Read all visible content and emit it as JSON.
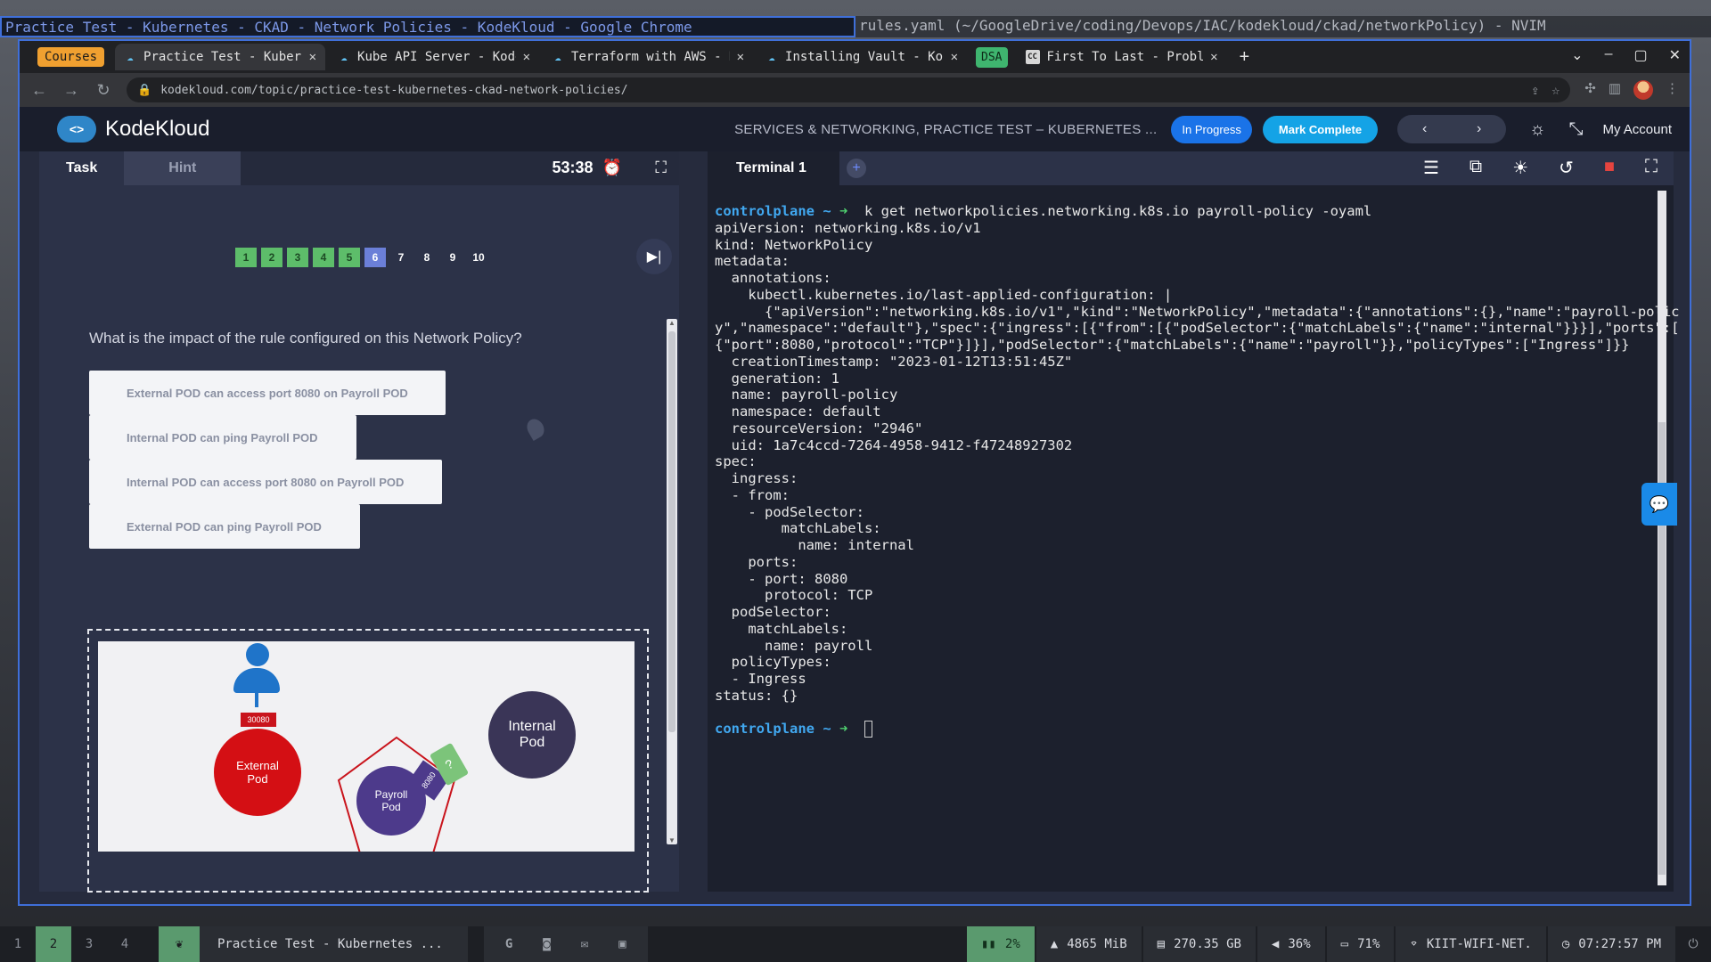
{
  "wm": {
    "left_title": "Practice Test - Kubernetes - CKAD - Network Policies - KodeKloud - Google Chrome",
    "right_title": "rules.yaml (~/GoogleDrive/coding/Devops/IAC/kodekloud/ckad/networkPolicy) - NVIM"
  },
  "browser": {
    "courses_badge": "Courses",
    "tabs": [
      {
        "label": "Practice Test - Kuberr",
        "active": true
      },
      {
        "label": "Kube API Server - Kode",
        "active": false
      },
      {
        "label": "Terraform with AWS - K",
        "active": false
      },
      {
        "label": "Installing Vault - Koc",
        "active": false
      },
      {
        "label": "First To Last - Proble",
        "active": false
      }
    ],
    "dsa_badge": "DSA",
    "cc_icon": "CC",
    "url": "kodekloud.com/topic/practice-test-kubernetes-ckad-network-policies/"
  },
  "header": {
    "logo_text": "KodeKloud",
    "course_title": "SERVICES & NETWORKING, PRACTICE TEST – KUBERNETES ...",
    "in_progress": "In Progress",
    "mark_complete": "Mark Complete",
    "my_account": "My Account"
  },
  "task": {
    "tab_task": "Task",
    "tab_hint": "Hint",
    "timer": "53:38",
    "question_numbers": [
      {
        "n": "1",
        "state": "done"
      },
      {
        "n": "2",
        "state": "done"
      },
      {
        "n": "3",
        "state": "done"
      },
      {
        "n": "4",
        "state": "done"
      },
      {
        "n": "5",
        "state": "done"
      },
      {
        "n": "6",
        "state": "current"
      },
      {
        "n": "7",
        "state": "todo"
      },
      {
        "n": "8",
        "state": "todo"
      },
      {
        "n": "9",
        "state": "todo"
      },
      {
        "n": "10",
        "state": "todo"
      }
    ],
    "question": "What is the impact of the rule configured on this Network Policy?",
    "options": [
      "External POD can access port 8080 on Payroll POD",
      "Internal POD can ping Payroll POD",
      "Internal POD can access port 8080 on Payroll POD",
      "External POD can ping Payroll POD"
    ],
    "diagram": {
      "port_label": "30080",
      "external_pod_l1": "External",
      "external_pod_l2": "Pod",
      "payroll_pod_l1": "Payroll",
      "payroll_pod_l2": "Pod",
      "internal_pod_l1": "Internal",
      "internal_pod_l2": "Pod",
      "tag_port": "8080",
      "tag_green": "?"
    }
  },
  "terminal": {
    "tab_label": "Terminal 1",
    "prompt": "controlplane ~",
    "command": "k get networkpolicies.networking.k8s.io payroll-policy -oyaml",
    "output": [
      "apiVersion: networking.k8s.io/v1",
      "kind: NetworkPolicy",
      "metadata:",
      "  annotations:",
      "    kubectl.kubernetes.io/last-applied-configuration: |",
      "      {\"apiVersion\":\"networking.k8s.io/v1\",\"kind\":\"NetworkPolicy\",\"metadata\":{\"annotations\":{},\"name\":\"payroll-polic",
      "y\",\"namespace\":\"default\"},\"spec\":{\"ingress\":[{\"from\":[{\"podSelector\":{\"matchLabels\":{\"name\":\"internal\"}}}],\"ports\":[",
      "{\"port\":8080,\"protocol\":\"TCP\"}]}],\"podSelector\":{\"matchLabels\":{\"name\":\"payroll\"}},\"policyTypes\":[\"Ingress\"]}}",
      "  creationTimestamp: \"2023-01-12T13:51:45Z\"",
      "  generation: 1",
      "  name: payroll-policy",
      "  namespace: default",
      "  resourceVersion: \"2946\"",
      "  uid: 1a7c4ccd-7264-4958-9412-f47248927302",
      "spec:",
      "  ingress:",
      "  - from:",
      "    - podSelector:",
      "        matchLabels:",
      "          name: internal",
      "    ports:",
      "    - port: 8080",
      "      protocol: TCP",
      "  podSelector:",
      "    matchLabels:",
      "      name: payroll",
      "  policyTypes:",
      "  - Ingress",
      "status: {}"
    ]
  },
  "statusbar": {
    "workspaces": [
      "1",
      "2",
      "3",
      "4"
    ],
    "active_workspace": "2",
    "window_title": "Practice Test - Kubernetes ...",
    "cpu": "2%",
    "memory": "4865 MiB",
    "disk": "270.35 GB",
    "volume": "36%",
    "battery": "71%",
    "wifi": "KIIT-WIFI-NET.",
    "clock": "07:27:57 PM"
  },
  "colors": {
    "accent_blue": "#1a73e8",
    "mark_complete": "#14a3e6",
    "done_green": "#5dbd6a",
    "current_purple": "#6b7fd8",
    "prompt_blue": "#41a8f0",
    "external_pod_red": "#d40f14",
    "payroll_pod_purple": "#4d3a8b"
  }
}
